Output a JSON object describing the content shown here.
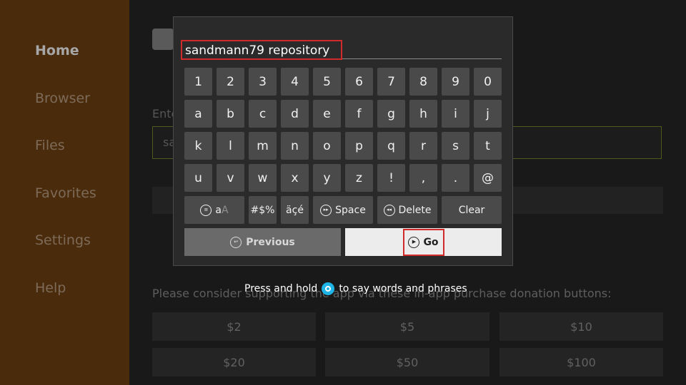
{
  "sidebar": {
    "items": [
      {
        "label": "Home",
        "active": true
      },
      {
        "label": "Browser"
      },
      {
        "label": "Files"
      },
      {
        "label": "Favorites"
      },
      {
        "label": "Settings"
      },
      {
        "label": "Help"
      }
    ]
  },
  "background": {
    "enter_label": "Ente",
    "url_value": "sa",
    "donate_text": "Please consider supporting the app via these in-app purchase donation buttons:",
    "donations": [
      "$2",
      "$5",
      "$10",
      "$20",
      "$50",
      "$100"
    ]
  },
  "keyboard": {
    "input_value": "sandmann79 repository",
    "rows": [
      [
        "1",
        "2",
        "3",
        "4",
        "5",
        "6",
        "7",
        "8",
        "9",
        "0"
      ],
      [
        "a",
        "b",
        "c",
        "d",
        "e",
        "f",
        "g",
        "h",
        "i",
        "j"
      ],
      [
        "k",
        "l",
        "m",
        "n",
        "o",
        "p",
        "q",
        "r",
        "s",
        "t"
      ],
      [
        "u",
        "v",
        "w",
        "x",
        "y",
        "z",
        "!",
        ",",
        ".",
        "@"
      ]
    ],
    "case_lower": "a",
    "case_upper": "A",
    "symbols_label": "#$%",
    "accents_label": "äçé",
    "space_label": "Space",
    "delete_label": "Delete",
    "clear_label": "Clear",
    "previous_label": "Previous",
    "go_label": "Go"
  },
  "voice_hint": {
    "before": "Press and hold",
    "after": "to say words and phrases"
  },
  "colors": {
    "sidebar_bg": "#4a2c0d",
    "highlight_red": "#d12a2a",
    "alexa_blue": "#1fb4e6"
  }
}
